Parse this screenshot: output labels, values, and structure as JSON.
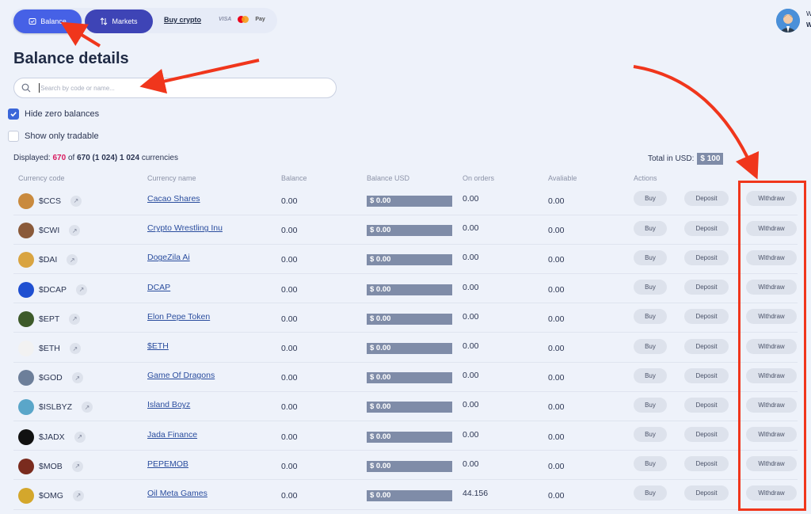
{
  "nav": {
    "balance_label": "Balance",
    "markets_label": "Markets",
    "buy_crypto_label": "Buy crypto",
    "pay_visa": "VISA",
    "pay_apple": "Pay"
  },
  "user": {
    "line1": "W",
    "line2": "W"
  },
  "page_title": "Balance details",
  "search": {
    "placeholder": "Search by code or name..."
  },
  "filters": {
    "hide_zero_label": "Hide zero balances",
    "hide_zero_checked": true,
    "only_tradable_label": "Show only tradable",
    "only_tradable_checked": false
  },
  "summary": {
    "displayed_label": "Displayed:",
    "displayed_count": "670",
    "of_label": "of",
    "total_count": "670 (1 024) 1 024",
    "currencies_label": "currencies",
    "total_usd_label": "Total in USD:",
    "total_usd_value": "$ 100"
  },
  "table": {
    "headers": [
      "Currency code",
      "Currency name",
      "Balance",
      "Balance USD",
      "On orders",
      "Avaliable",
      "Actions"
    ],
    "buy_label": "Buy",
    "deposit_label": "Deposit",
    "withdraw_label": "Withdraw",
    "rows": [
      {
        "code": "$CCS",
        "name": "Cacao Shares",
        "balance": "0.00",
        "usd": "$ 0.00",
        "orders": "0.00",
        "available": "0.00",
        "color": "#c98a3e"
      },
      {
        "code": "$CWI",
        "name": "Crypto Wrestling Inu",
        "balance": "0.00",
        "usd": "$ 0.00",
        "orders": "0.00",
        "available": "0.00",
        "color": "#8a5a3a"
      },
      {
        "code": "$DAI",
        "name": "DogeZila Ai",
        "balance": "0.00",
        "usd": "$ 0.00",
        "orders": "0.00",
        "available": "0.00",
        "color": "#d9a441"
      },
      {
        "code": "$DCAP",
        "name": "DCAP",
        "balance": "0.00",
        "usd": "$ 0.00",
        "orders": "0.00",
        "available": "0.00",
        "color": "#1f4fd1"
      },
      {
        "code": "$EPT",
        "name": "Elon Pepe Token",
        "balance": "0.00",
        "usd": "$ 0.00",
        "orders": "0.00",
        "available": "0.00",
        "color": "#3d5a2a"
      },
      {
        "code": "$ETH",
        "name": "$ETH",
        "balance": "0.00",
        "usd": "$ 0.00",
        "orders": "0.00",
        "available": "0.00",
        "color": "#f2f2f2"
      },
      {
        "code": "$GOD",
        "name": "Game Of Dragons",
        "balance": "0.00",
        "usd": "$ 0.00",
        "orders": "0.00",
        "available": "0.00",
        "color": "#6d7f9a"
      },
      {
        "code": "$ISLBYZ",
        "name": "Island Boyz",
        "balance": "0.00",
        "usd": "$ 0.00",
        "orders": "0.00",
        "available": "0.00",
        "color": "#5aa6c9"
      },
      {
        "code": "$JADX",
        "name": "Jada Finance",
        "balance": "0.00",
        "usd": "$ 0.00",
        "orders": "0.00",
        "available": "0.00",
        "color": "#111111"
      },
      {
        "code": "$MOB",
        "name": "PEPEMOB",
        "balance": "0.00",
        "usd": "$ 0.00",
        "orders": "0.00",
        "available": "0.00",
        "color": "#7a2b1e"
      },
      {
        "code": "$OMG",
        "name": "Oil Meta Games",
        "balance": "0.00",
        "usd": "$ 0.00",
        "orders": "44.156",
        "available": "0.00",
        "color": "#d4a72c"
      }
    ]
  },
  "colors": {
    "accent": "#4661e6",
    "annotation": "#f0361c",
    "usd_bar": "#7f8ca8"
  }
}
